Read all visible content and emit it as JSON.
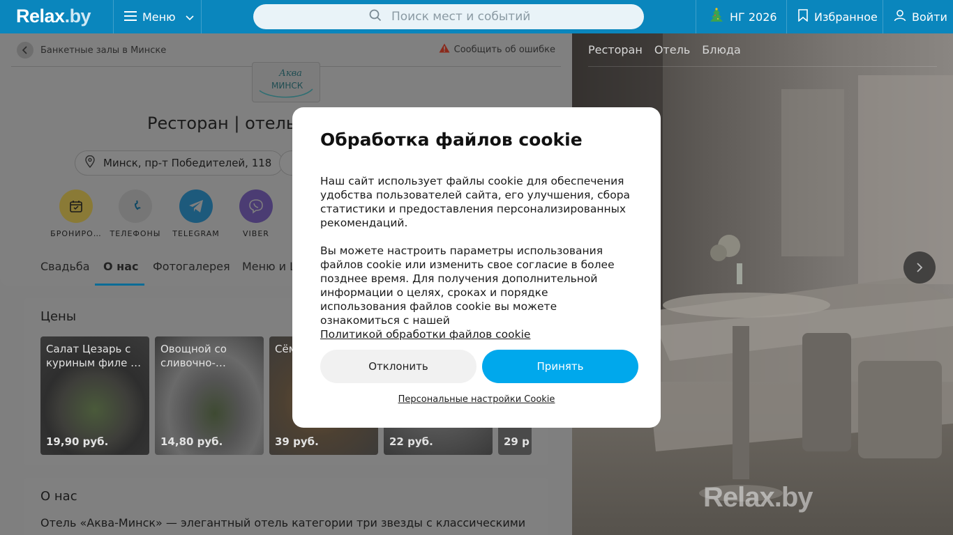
{
  "header": {
    "logo": "Relax",
    "logo_suffix": ".by",
    "menu_label": "Меню",
    "search_placeholder": "Поиск мест и событий",
    "ny_label": "НГ 2026",
    "favorites_label": "Избранное",
    "login_label": "Войти"
  },
  "breadcrumb": {
    "label": "Банкетные залы в Минске"
  },
  "report_label": "Сообщить об ошибке",
  "business": {
    "logo_text_top": "Аква",
    "logo_text_bottom": "МИНСК",
    "title": "Ресторан | отель",
    "address": "Минск, пр-т Победителей, 118"
  },
  "actions": [
    {
      "label": "БРОНИРО…",
      "color": "#d6b72a"
    },
    {
      "label": "ТЕЛЕФОНЫ",
      "color": "#6f6f6f"
    },
    {
      "label": "TELEGRAM",
      "color": "#1e86c1"
    },
    {
      "label": "VIBER",
      "color": "#6a4bb6"
    }
  ],
  "tabs": [
    "Свадьба",
    "О нас",
    "Фотогалерея",
    "Меню и Ц"
  ],
  "active_tab": "О нас",
  "prices": {
    "title": "Цены",
    "dishes": [
      {
        "name": "Салат Цезарь с куриным филе …",
        "price": "19,90 руб."
      },
      {
        "name": "Овощной со сливочно-…",
        "price": "14,80 руб."
      },
      {
        "name": "Сёмга под…",
        "price": "39 руб."
      },
      {
        "name": "",
        "price": "22 руб."
      },
      {
        "name": "",
        "price": "29 р"
      }
    ]
  },
  "about": {
    "title": "О нас",
    "text": "Отель «Аква-Минск» — элегантный отель категории три звезды с классическими"
  },
  "gallery": {
    "tabs": [
      "Ресторан",
      "Отель",
      "Блюда"
    ],
    "watermark": "Relax.by"
  },
  "cookie_modal": {
    "title": "Обработка файлов cookie",
    "para1": "Наш сайт использует файлы cookie для обеспечения удобства пользователей сайта, его улучшения, сбора статистики и предоставления персонализированных рекомендаций.",
    "para2": "Вы можете настроить параметры использования файлов cookie или изменить свое согласие в более позднее время. Для получения дополнительной информации о целях, сроках и порядке использования файлов cookie вы можете ознакомиться с нашей",
    "policy_link": "Политикой обработки файлов cookie",
    "decline_label": "Отклонить",
    "accept_label": "Принять",
    "personal_settings_label": "Персональные настройки Cookie"
  },
  "colors": {
    "header_bg": "#0a86bd",
    "accept_bg": "#00a8ec",
    "decline_bg": "#f1f1f1",
    "overlay": "rgba(0,0,0,0.5)"
  }
}
